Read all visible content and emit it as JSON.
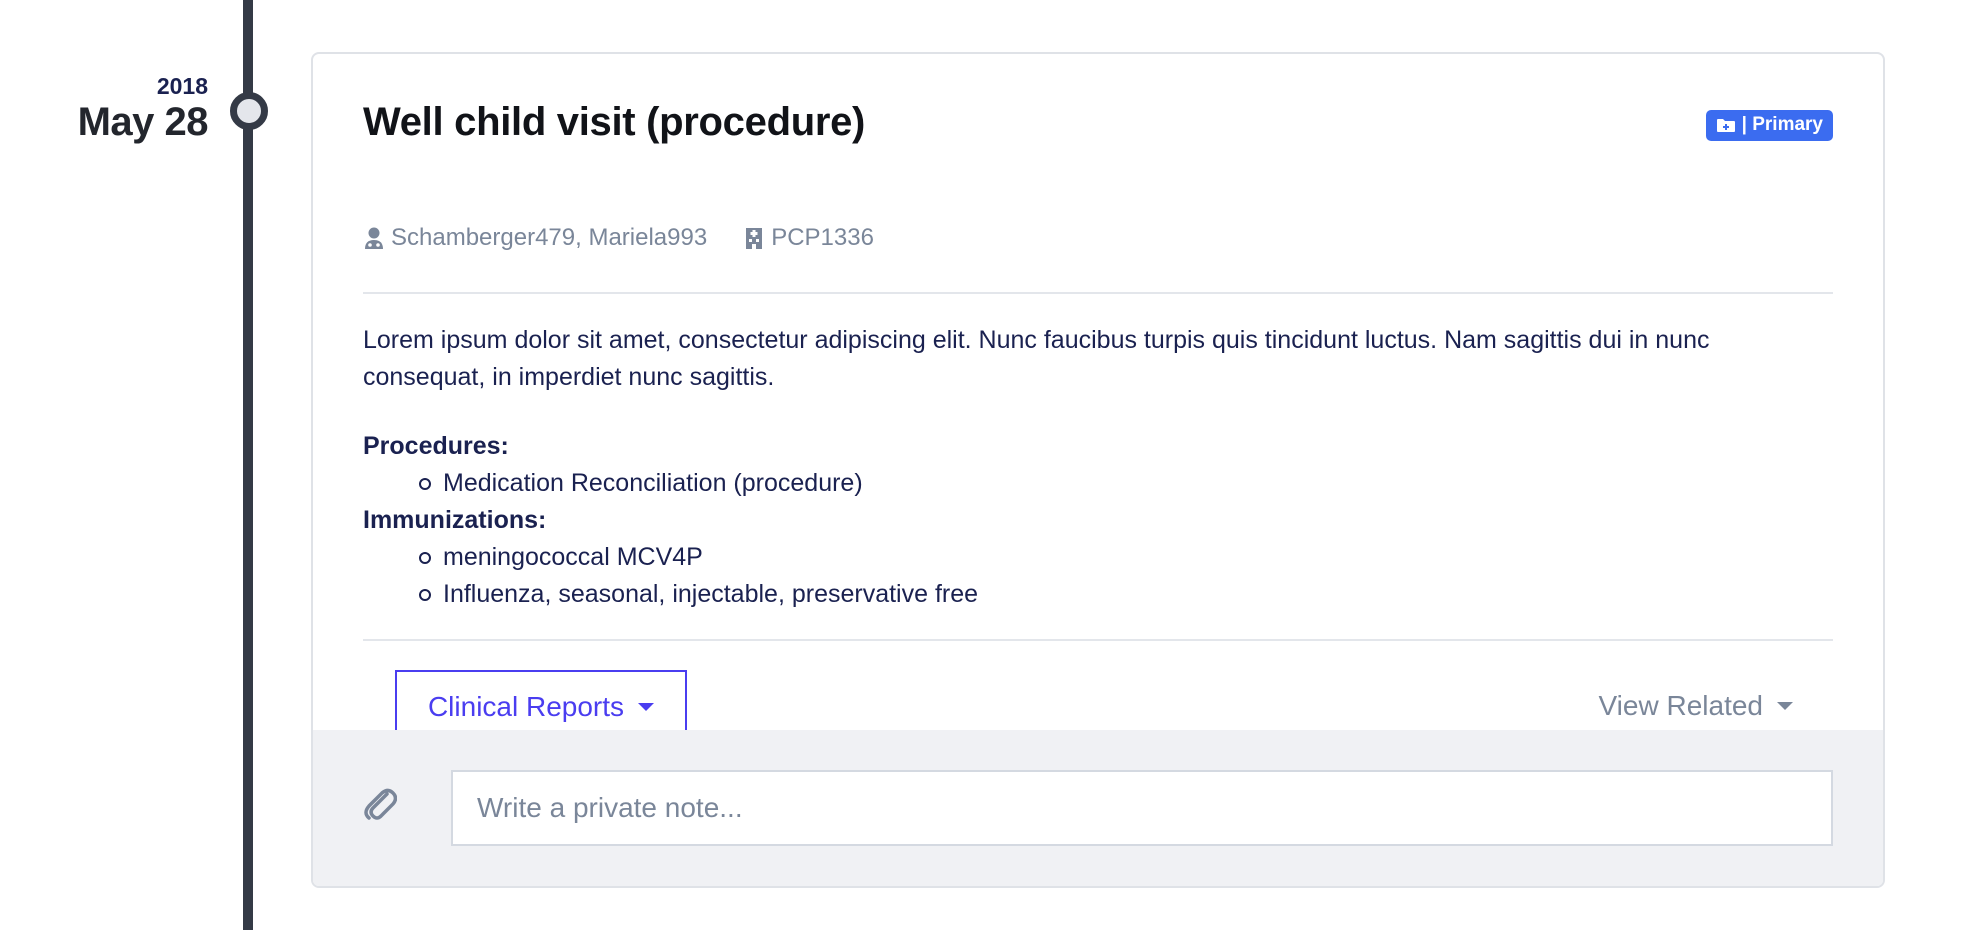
{
  "timeline": {
    "year": "2018",
    "day": "May 28"
  },
  "encounter": {
    "title": "Well child visit (procedure)",
    "badge": "| Primary",
    "provider": "Schamberger479, Mariela993",
    "organization": "PCP1336",
    "description": "Lorem ipsum dolor sit amet, consectetur adipiscing elit. Nunc faucibus turpis quis tincidunt luctus. Nam sagittis dui in nunc consequat, in imperdiet nunc sagittis.",
    "procedures_label": "Procedures:",
    "procedures": [
      "Medication Reconciliation (procedure)"
    ],
    "immunizations_label": "Immunizations:",
    "immunizations": [
      "meningococcal MCV4P",
      "Influenza, seasonal, injectable, preservative free"
    ]
  },
  "actions": {
    "clinical_reports": "Clinical Reports",
    "view_related": "View Related"
  },
  "note": {
    "placeholder": "Write a private note..."
  },
  "colors": {
    "accent": "#4a3df0",
    "badge": "#3b6cf0",
    "timeline": "#343a46",
    "muted": "#7a8699",
    "text": "#1a2150"
  },
  "icons": {
    "badge": "folder-plus-icon",
    "provider": "user-doctor-icon",
    "organization": "hospital-icon",
    "attach": "paperclip-icon"
  }
}
